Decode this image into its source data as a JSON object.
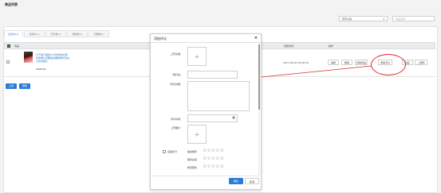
{
  "page": {
    "title": "商品列表"
  },
  "filters": {
    "category_value": "所有分组",
    "search_placeholder": "商品名称"
  },
  "tabs": [
    {
      "label": "出售中(1)",
      "active": true
    },
    {
      "label": "仓库中(1)",
      "active": false
    },
    {
      "label": "已售罄(0)",
      "active": false
    },
    {
      "label": "待审核(0)",
      "active": false
    },
    {
      "label": "已删除(0)",
      "active": false
    }
  ],
  "table": {
    "headers": {
      "product": "商品",
      "created": "创建时间",
      "actions": "操作"
    },
    "rows": [
      {
        "name": "大于等于搬家07月份新款女装时尚网纱高腰连衣裙夏季长款女士修身裙子",
        "price": "¥499.00",
        "created": "2017-05-10 16:06:34",
        "actions": [
          "编辑",
          "删除",
          "复制商品",
          "添加评价",
          "链接",
          "二维码"
        ]
      }
    ]
  },
  "bulk_actions": {
    "put_on": "上架",
    "delete": "删除"
  },
  "modal": {
    "title": "添加评论",
    "close": "×",
    "fields": {
      "avatar_label": "上传头像：",
      "username_label": "*用户名：",
      "content_label": "*评论内容：",
      "time_label": "评价时间：",
      "images_label": "上传图片："
    },
    "ratings": {
      "checkbox_label": "店铺评分",
      "rows": [
        {
          "label": "描述相符",
          "stars": 5
        },
        {
          "label": "服务态度",
          "stars": 5
        },
        {
          "label": "物流服务",
          "stars": 5
        }
      ]
    },
    "ok": "确定",
    "cancel": "取消"
  },
  "colors": {
    "primary": "#2f7cd6",
    "annotation": "#d92b2b"
  }
}
